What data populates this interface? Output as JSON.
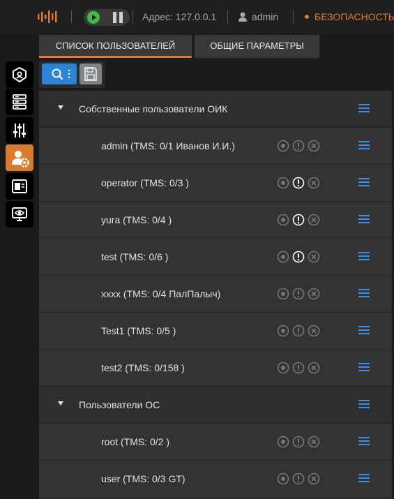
{
  "header": {
    "address": "Адрес: 127.0.0.1",
    "user": "admin",
    "security": "БЕЗОПАСНОСТЬ",
    "accent_color": "#e07b2d",
    "play_color": "#3fbf3f"
  },
  "tabs": [
    {
      "label": "СПИСОК ПОЛЬЗОВАТЕЛЕЙ",
      "active": true
    },
    {
      "label": "ОБЩИЕ ПАРАМЕТРЫ",
      "active": false
    }
  ],
  "toolbar": {
    "search_icon": "search-icon",
    "save_icon": "floppy-disk-icon"
  },
  "sidebar": {
    "items": [
      {
        "icon": "shield-icon",
        "active": false
      },
      {
        "icon": "server-stack-icon",
        "active": false
      },
      {
        "icon": "sliders-icon",
        "active": false
      },
      {
        "icon": "user-settings-icon",
        "active": true
      },
      {
        "icon": "terminal-box-icon",
        "active": false
      },
      {
        "icon": "monitor-eye-icon",
        "active": false
      }
    ]
  },
  "groups": [
    {
      "label": "Собственные пользователи ОИК",
      "users": [
        {
          "label": "admin (TMS: 0/1 Иванов И.И.)",
          "warn_highlight": false
        },
        {
          "label": "operator (TMS: 0/3 )",
          "warn_highlight": true
        },
        {
          "label": "yura (TMS: 0/4 )",
          "warn_highlight": true
        },
        {
          "label": "test (TMS: 0/6 )",
          "warn_highlight": true
        },
        {
          "label": "xxxx (TMS: 0/4 ПалПалыч)",
          "warn_highlight": false
        },
        {
          "label": "Test1 (TMS: 0/5 )",
          "warn_highlight": false
        },
        {
          "label": "test2 (TMS: 0/158 )",
          "warn_highlight": false
        }
      ]
    },
    {
      "label": "Пользователи ОС",
      "users": [
        {
          "label": "root (TMS: 0/2 )",
          "warn_highlight": false
        },
        {
          "label": "user (TMS: 0/3 GT)",
          "warn_highlight": false
        }
      ]
    }
  ]
}
